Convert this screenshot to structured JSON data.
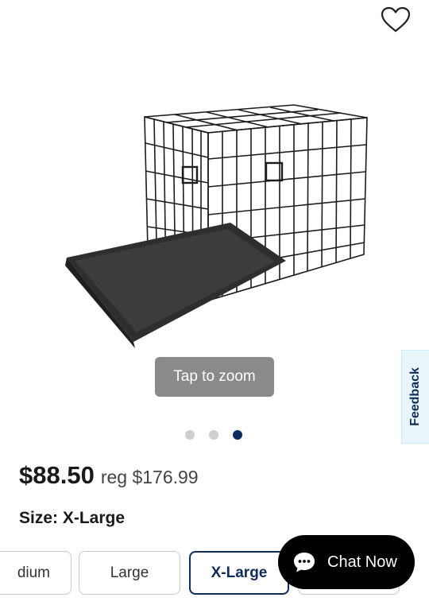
{
  "image_alt": "Wire dog crate",
  "zoom": {
    "label": "Tap to zoom"
  },
  "carousel": {
    "count": 3,
    "active_index": 2
  },
  "feedback": {
    "label": "Feedback"
  },
  "pricing": {
    "price": "$88.50",
    "reg": "reg $176.99"
  },
  "size": {
    "label": "Size: X-Large",
    "options": [
      {
        "label": "Medium",
        "visible_text": "dium",
        "selected": false
      },
      {
        "label": "Large",
        "visible_text": "Large",
        "selected": false
      },
      {
        "label": "X-Large",
        "visible_text": "X-Large",
        "selected": true
      },
      {
        "label": "",
        "visible_text": "",
        "selected": false
      }
    ]
  },
  "chat": {
    "label": "Chat Now"
  },
  "colors": {
    "navy": "#0f2b5b",
    "zoom_bg": "#8a8a8a",
    "feedback_bg": "#e8f6fb",
    "chat_bg": "#000000"
  }
}
